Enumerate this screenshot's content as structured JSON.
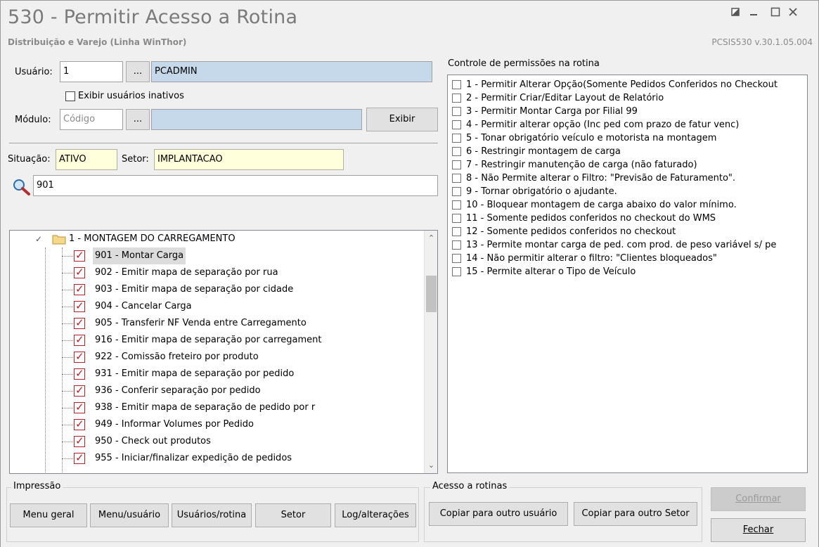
{
  "window": {
    "title": "530 - Permitir Acesso a Rotina",
    "subtitle": "Distribuição e Varejo (Linha WinThor)",
    "version": "PCSIS530  v.30.1.05.004"
  },
  "form": {
    "usuario_label": "Usuário:",
    "usuario_code": "1",
    "usuario_lookup": "...",
    "usuario_name": "PCADMIN",
    "inativos_label": "Exibir usuários inativos",
    "modulo_label": "Módulo:",
    "modulo_placeholder": "Código",
    "modulo_lookup": "...",
    "modulo_name": "",
    "exibir_button": "Exibir",
    "situacao_label": "Situação:",
    "situacao_value": "ATIVO",
    "setor_label": "Setor:",
    "setor_value": "IMPLANTACAO",
    "search_value": "901"
  },
  "tree": {
    "group_label": "1 - MONTAGEM DO CARREGAMENTO",
    "items": [
      {
        "label": "901 - Montar Carga",
        "checked": true,
        "selected": true
      },
      {
        "label": "902 - Emitir mapa de separação por rua",
        "checked": true
      },
      {
        "label": "903 - Emitir mapa de separação por cidade",
        "checked": true
      },
      {
        "label": "904 - Cancelar Carga",
        "checked": true
      },
      {
        "label": "905 - Transferir NF Venda entre Carregamento",
        "checked": true
      },
      {
        "label": "916 - Emitir mapa de separação por carregament",
        "checked": true
      },
      {
        "label": "922 - Comissão freteiro por produto",
        "checked": true
      },
      {
        "label": "931 - Emitir mapa de separação por pedido",
        "checked": true
      },
      {
        "label": "936 - Conferir separação por pedido",
        "checked": true
      },
      {
        "label": "938 - Emitir mapa de separação de pedido por r",
        "checked": true
      },
      {
        "label": "949 - Informar Volumes por Pedido",
        "checked": true
      },
      {
        "label": "950 - Check out produtos",
        "checked": true
      },
      {
        "label": "955 - Iniciar/finalizar expedição de pedidos",
        "checked": true
      }
    ]
  },
  "permissions": {
    "title": "Controle de permissões na rotina",
    "items": [
      "1 - Permitir Alterar Opção(Somente Pedidos Conferidos no Checkout",
      "2 - Permitir Criar/Editar Layout de Relatório",
      "3 - Permitir Montar Carga por Filial 99",
      "4 - Permitir alterar opção (Inc ped com prazo de fatur venc)",
      "5 - Tonar obrigatório veículo e motorista na montagem",
      "6 - Restringir montagem de carga",
      "7 - Restringir manutenção de carga (não faturado)",
      "8 - Não Permite alterar o Filtro: \"Previsão de Faturamento\".",
      "9 - Tornar obrigatório o ajudante.",
      "10 - Bloquear montagem de carga abaixo do valor mínimo.",
      "11 - Somente pedidos conferidos no checkout do WMS",
      "12 - Somente pedidos conferidos no checkout",
      "13 - Permite montar carga de ped. com prod. de peso variável s/ pe",
      "14 - Não permitir alterar o filtro: \"Clientes bloqueados\"",
      "15 - Permite alterar o Tipo de Veículo"
    ]
  },
  "impressao": {
    "title": "Impressão",
    "menu_geral": "Menu geral",
    "menu_usuario": "Menu/usuário",
    "usuarios_rotina": "Usuários/rotina",
    "setor": "Setor",
    "log_alteracoes": "Log/alterações"
  },
  "acesso": {
    "title": "Acesso a rotinas",
    "copiar_usuario": "Copiar para outro usuário",
    "copiar_setor": "Copiar para outro Setor"
  },
  "actions": {
    "confirmar": "Confirmar",
    "fechar": "Fechar"
  }
}
